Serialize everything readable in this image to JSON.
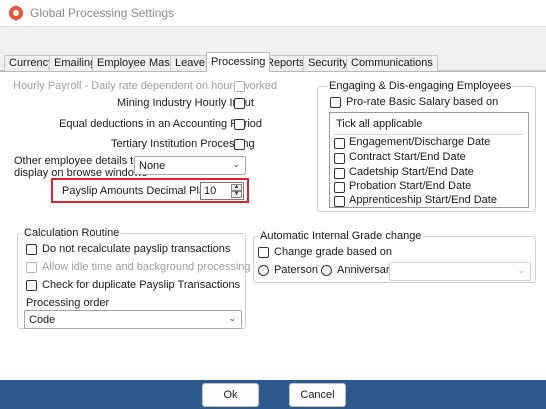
{
  "window": {
    "title": "Global Processing Settings",
    "icon": "gear-settings-icon"
  },
  "tabs": [
    {
      "label": "Currency"
    },
    {
      "label": "Emailing"
    },
    {
      "label": "Employee Master"
    },
    {
      "label": "Leave"
    },
    {
      "label": "Processing",
      "active": true
    },
    {
      "label": "Reports"
    },
    {
      "label": "Security"
    },
    {
      "label": "Communications"
    }
  ],
  "left": {
    "hourly_payroll": {
      "label": "Hourly Payroll - Daily rate dependent on hours worked",
      "checked": false,
      "enabled": false
    },
    "mining": {
      "label": "Mining Industry Hourly Input",
      "checked": false
    },
    "equal_deductions": {
      "label": "Equal deductions in an Accounting Period",
      "checked": false
    },
    "tertiary": {
      "label": "Tertiary Institution Processing",
      "checked": false
    },
    "other_details_line1": "Other employee details to",
    "other_details_line2": "display on browse windows",
    "other_details_value": "None",
    "decimal_places_label": "Payslip Amounts Decimal Places",
    "decimal_places_value": "10"
  },
  "calculation": {
    "title": "Calculation Routine",
    "do_not_recalc": {
      "label": "Do not recalculate payslip transactions",
      "checked": false
    },
    "idle_time": {
      "label": "Allow idle time and background processing",
      "checked": false,
      "enabled": false
    },
    "duplicate": {
      "label": "Check for duplicate Payslip Transactions",
      "checked": false
    },
    "processing_order_label": "Processing order",
    "processing_order_value": "Code"
  },
  "engaging": {
    "title": "Engaging & Dis-engaging Employees",
    "prorate": {
      "label": "Pro-rate Basic Salary based on",
      "checked": false
    },
    "tick_all": "Tick all applicable",
    "items": [
      {
        "label": "Engagement/Discharge Date",
        "checked": false
      },
      {
        "label": "Contract Start/End Date",
        "checked": false
      },
      {
        "label": "Cadetship Start/End Date",
        "checked": false
      },
      {
        "label": "Probation Start/End Date",
        "checked": false
      },
      {
        "label": "Apprenticeship Start/End Date",
        "checked": false
      }
    ]
  },
  "grade": {
    "title": "Automatic Internal Grade change",
    "change_grade": {
      "label": "Change grade based on",
      "checked": false
    },
    "paterson": "Paterson",
    "anniversary": "Anniversary",
    "anniversary_value": ""
  },
  "buttons": {
    "ok": "Ok",
    "cancel": "Cancel"
  },
  "colors": {
    "footer": "#2d5a8e",
    "highlight": "#e0202a"
  }
}
